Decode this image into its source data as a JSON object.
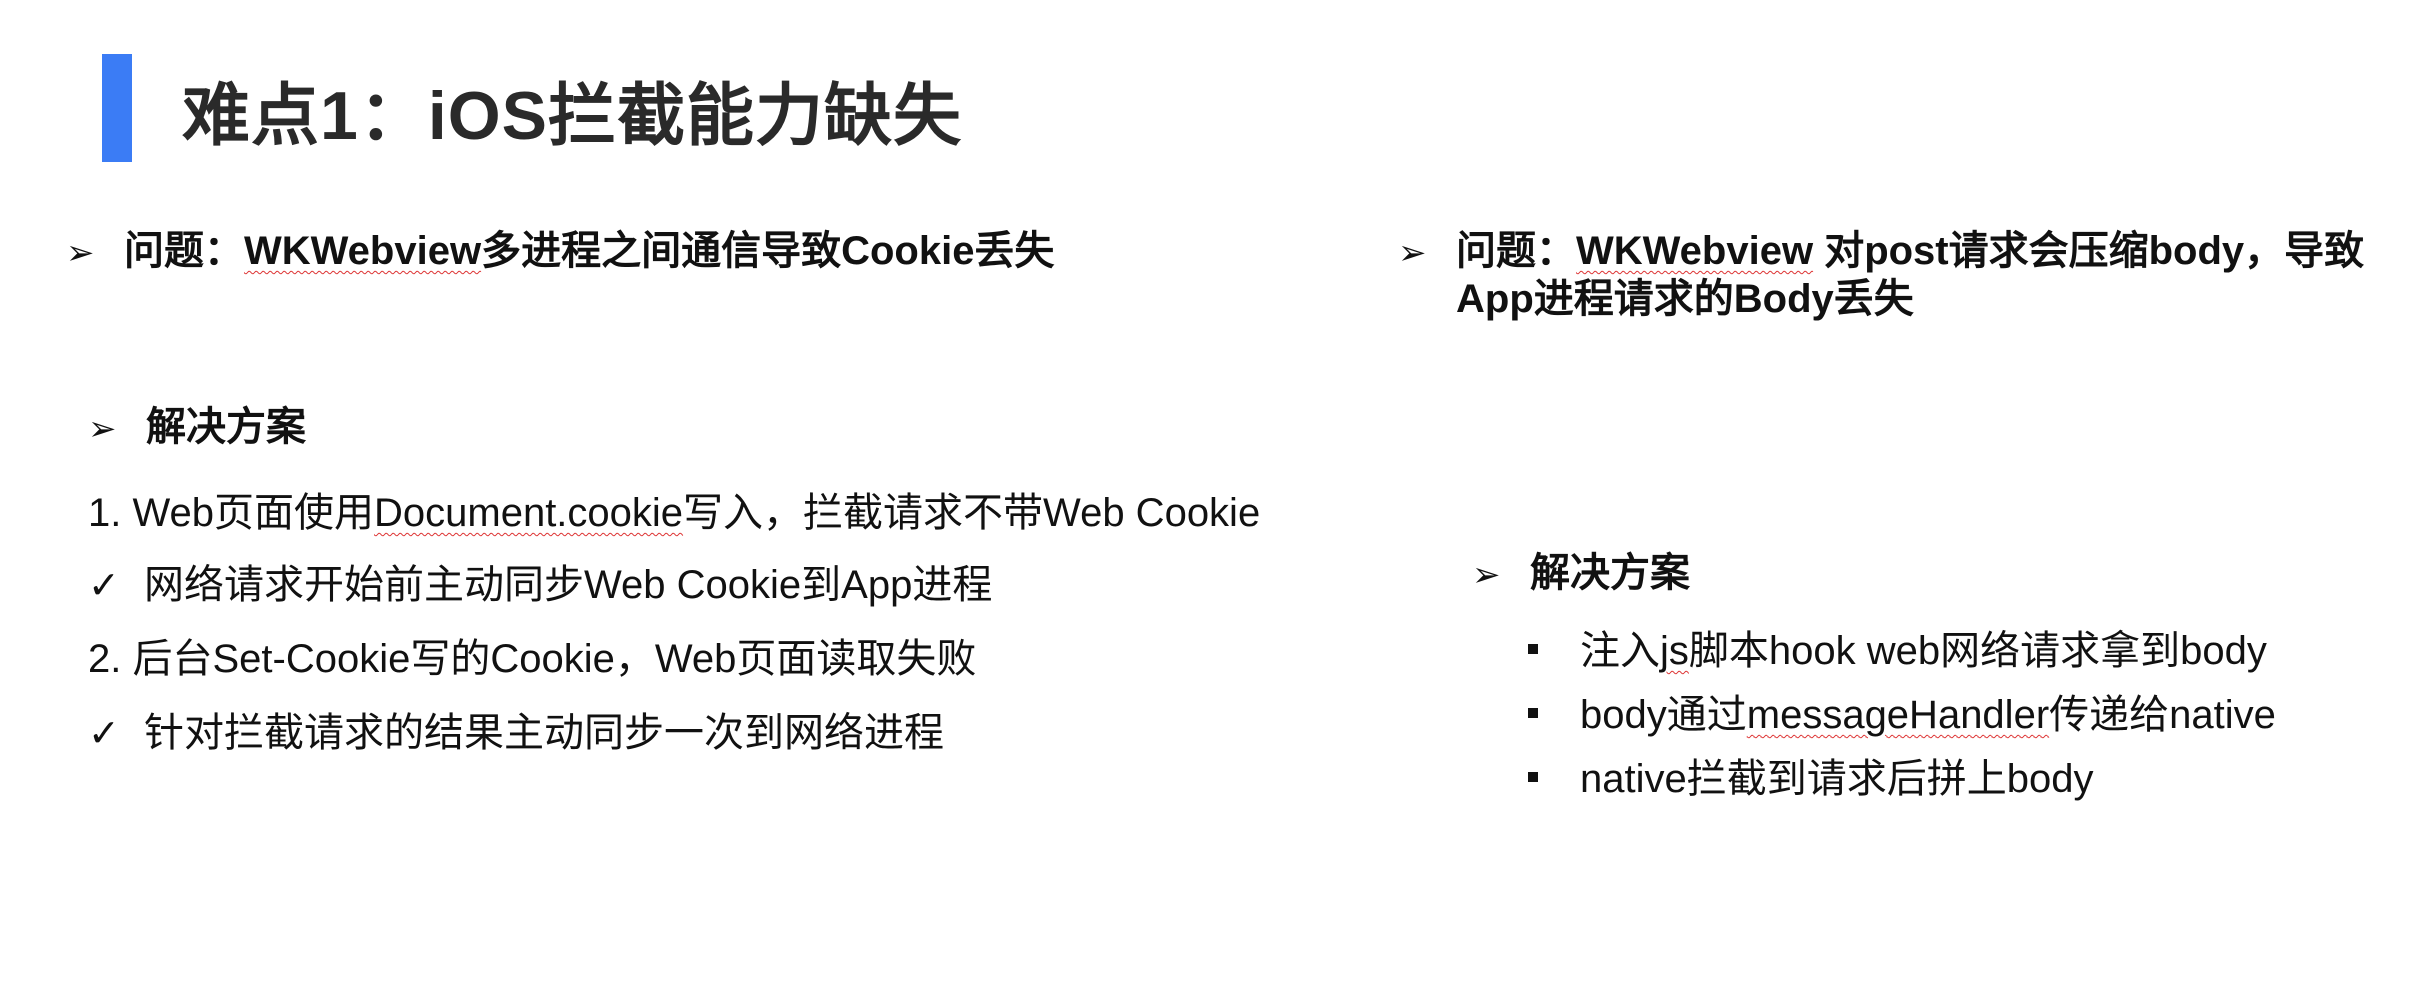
{
  "slide": {
    "title": "难点1：iOS拦截能力缺失",
    "accent_color": "#3b7cf5"
  },
  "left": {
    "problem_prefix": "问题：",
    "problem_brand": "WKWebview",
    "problem_rest": "多进程之间通信导致Cookie丢失",
    "solution_heading": "解决方案",
    "item1_a": "1. Web页面使用",
    "item1_b": "Document.cookie",
    "item1_c": "写入，拦截请求不带Web Cookie",
    "check1": "网络请求开始前主动同步Web Cookie到App进程",
    "item2": "2. 后台Set-Cookie写的Cookie，Web页面读取失败",
    "check2": "针对拦截请求的结果主动同步一次到网络进程"
  },
  "right": {
    "problem_line1_prefix": "问题：",
    "problem_line1_brand": "WKWebview",
    "problem_line1_rest": " 对post请求会压缩body，导致",
    "problem_line2": "App进程请求的Body丢失",
    "solution_heading": "解决方案",
    "b1_a": "注入",
    "b1_b": "js",
    "b1_c": "脚本hook web网络请求拿到body",
    "b2_a": "body通过",
    "b2_b": "messageHandler",
    "b2_c": "传递给native",
    "b3": "native拦截到请求后拼上body"
  },
  "icons": {
    "arrow": "➢",
    "check": "✓"
  }
}
